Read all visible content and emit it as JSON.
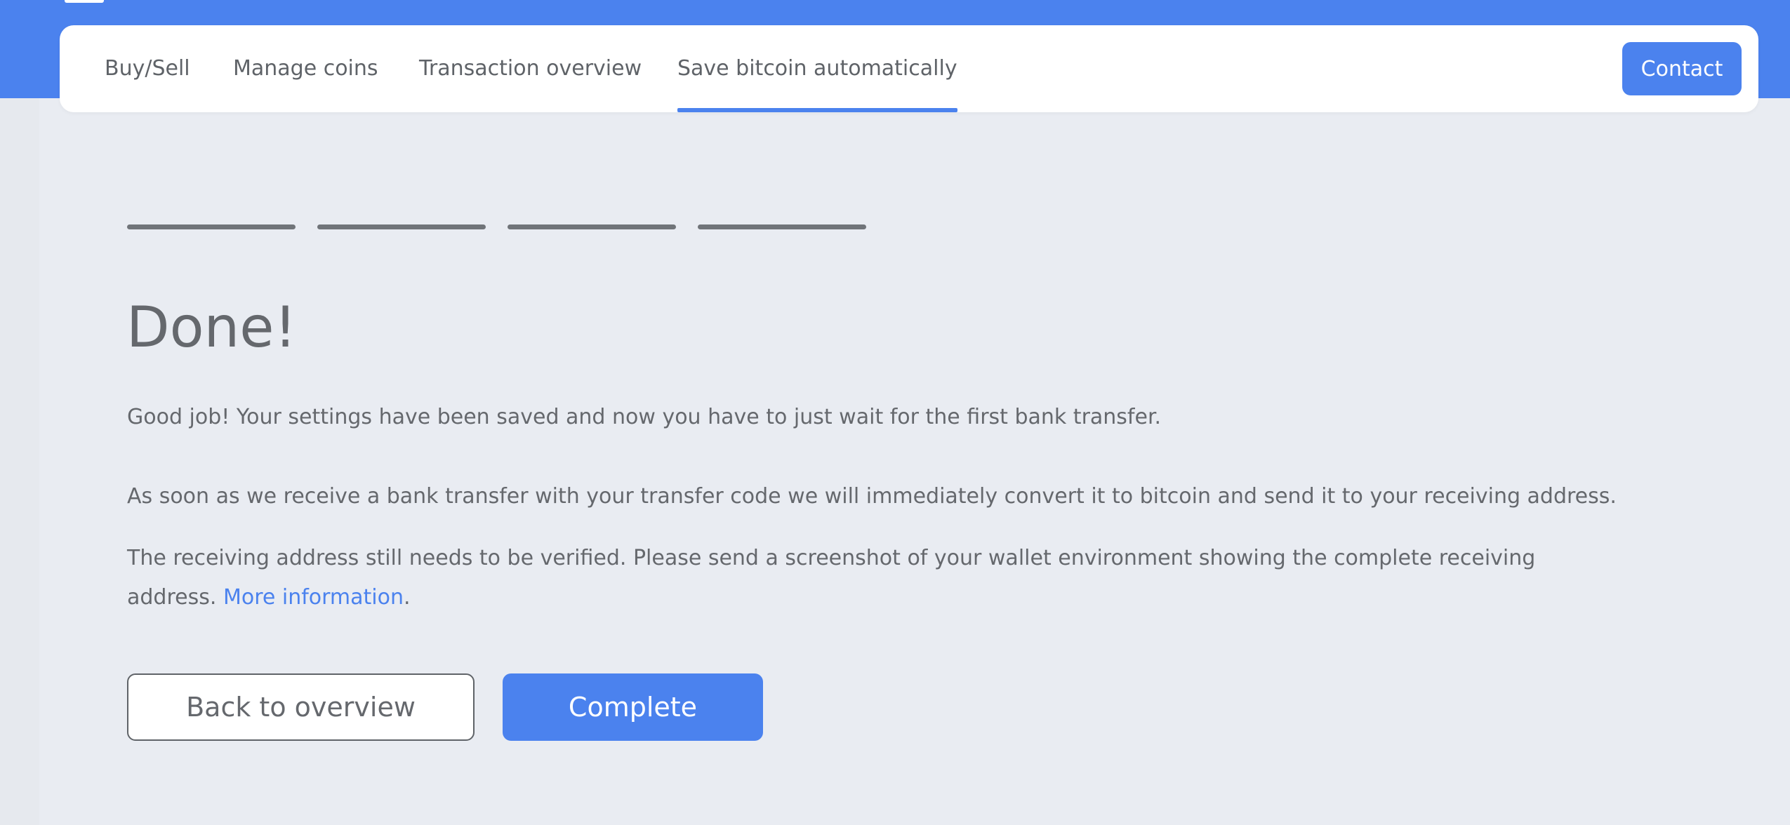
{
  "nav": {
    "tabs": [
      {
        "label": "Buy/Sell"
      },
      {
        "label": "Manage coins"
      },
      {
        "label": "Transaction overview"
      },
      {
        "label": "Save bitcoin automatically",
        "active": true
      }
    ],
    "contact_label": "Contact"
  },
  "steps": {
    "total": 4,
    "completed": 4
  },
  "main": {
    "title": "Done!",
    "para1": "Good job! Your settings have been saved and now you have to just wait for the first bank transfer.",
    "para2": "As soon as we receive a bank transfer with your transfer code we will immediately convert it to bitcoin and send it to your receiving address.",
    "para3_text": "The receiving address still needs to be verified. Please send a screenshot of your wallet environment showing the complete receiving address.",
    "para3_link": "More information",
    "para3_end": ".",
    "back_label": "Back to overview",
    "complete_label": "Complete"
  },
  "colors": {
    "accent": "#4b82ee",
    "background": "#e9ecf2",
    "text": "#65686d"
  }
}
